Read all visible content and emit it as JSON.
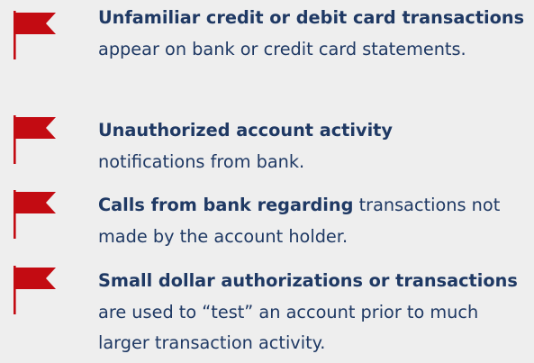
{
  "colors": {
    "background": "#eeeeee",
    "text": "#1f3964",
    "flag": "#c30b12",
    "pole": "#c30b12"
  },
  "items": [
    {
      "icon": "red-flag-icon",
      "bold": "Unfamiliar credit or debit card transactions",
      "rest": " appear on bank or credit card statements."
    },
    {
      "icon": "red-flag-icon",
      "bold": "Unauthorized account activity",
      "rest": " notifications from bank."
    },
    {
      "icon": "red-flag-icon",
      "bold": "Calls from bank regarding",
      "rest": " transactions not made by the account holder."
    },
    {
      "icon": "red-flag-icon",
      "bold": "Small dollar authorizations or transactions",
      "rest": " are used to “test” an account prior to much larger transaction activity."
    }
  ]
}
